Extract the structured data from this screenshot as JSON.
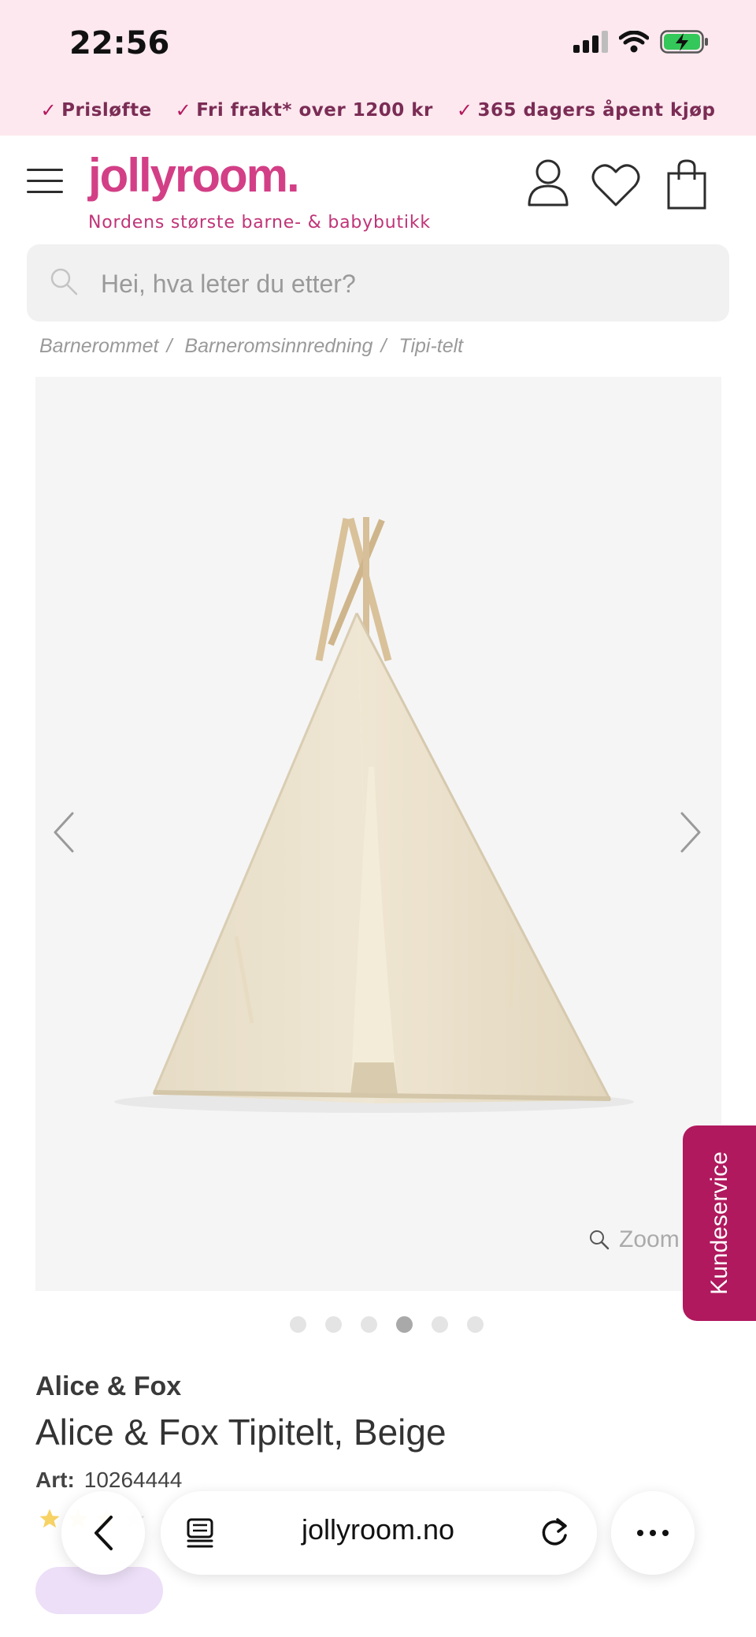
{
  "status_bar": {
    "time": "22:56"
  },
  "usp": [
    {
      "label": "Prisløfte"
    },
    {
      "label": "Fri frakt* over 1200 kr"
    },
    {
      "label": "365 dagers åpent kjøp"
    }
  ],
  "header": {
    "logo": "jollyroom.",
    "tagline": "Nordens største barne- & babybutikk"
  },
  "search": {
    "placeholder": "Hei, hva leter du etter?"
  },
  "breadcrumb": [
    {
      "label": "Barnerommet"
    },
    {
      "label": "Barneromsinnredning"
    },
    {
      "label": "Tipi-telt"
    }
  ],
  "gallery": {
    "zoom_label": "Zoom",
    "dots_count": 6,
    "active_dot": 4
  },
  "kundeservice": {
    "label": "Kundeservice"
  },
  "product": {
    "brand": "Alice & Fox",
    "title": "Alice & Fox Tipitelt, Beige",
    "art_label": "Art:",
    "art_number": "10264444"
  },
  "browser": {
    "url": "jollyroom.no"
  },
  "colors": {
    "brand_pink": "#d33f86",
    "banner_bg": "#fce8ee",
    "kundeservice_bg": "#b0195e"
  }
}
